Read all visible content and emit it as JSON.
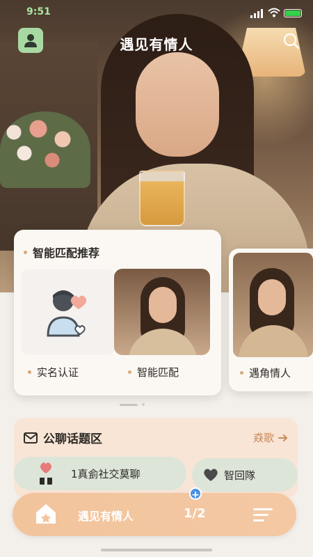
{
  "status_bar": {
    "time": "9:51"
  },
  "header": {
    "title": "遇见有情人"
  },
  "recommend": {
    "title": "智能匹配推荐",
    "tiles": [
      {
        "label": "实名认证"
      },
      {
        "label": "智能匹配"
      },
      {
        "label": "遇角情人"
      }
    ]
  },
  "topic": {
    "title": "公聊话题区",
    "more": "猋歌",
    "chips": [
      {
        "label": "1真侴社交莫聊"
      },
      {
        "label": "智回隊"
      }
    ]
  },
  "bottom_bar": {
    "label": "遇见有情人",
    "page": "1/2"
  },
  "colors": {
    "accent": "#f2c49c",
    "brand_green": "#a9d9a3",
    "chip_bg": "#dde5d9",
    "topic_bg": "#f8e5d6"
  },
  "icons": [
    "user-avatar-icon",
    "search-icon",
    "verify-user-heart-icon",
    "mail-icon",
    "arrow-right-icon",
    "heart-icon",
    "home-star-icon",
    "menu-icon",
    "plus-icon"
  ]
}
